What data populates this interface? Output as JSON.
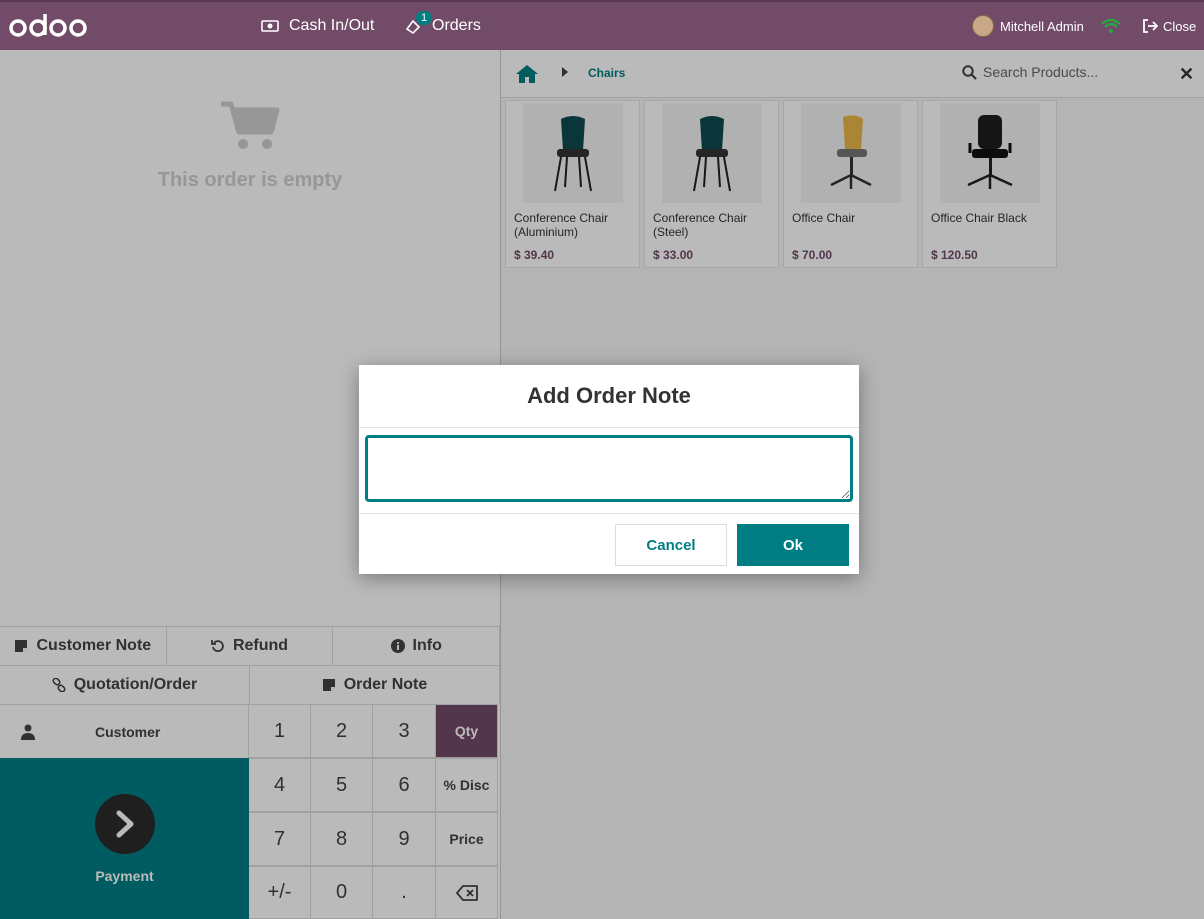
{
  "header": {
    "logo_text": "odoo",
    "cash_label": "Cash In/Out",
    "orders_label": "Orders",
    "orders_count": "1",
    "user_name": "Mitchell Admin",
    "close_label": "Close"
  },
  "order": {
    "empty_text": "This order is empty"
  },
  "controls": {
    "customer_note": "Customer Note",
    "refund": "Refund",
    "info": "Info",
    "quotation": "Quotation/Order",
    "order_note": "Order Note",
    "customer": "Customer",
    "payment": "Payment"
  },
  "numpad": {
    "keys": [
      "1",
      "2",
      "3",
      "Qty",
      "4",
      "5",
      "6",
      "% Disc",
      "7",
      "8",
      "9",
      "Price",
      "+/-",
      "0",
      "."
    ]
  },
  "products_panel": {
    "breadcrumb": "Chairs",
    "search_placeholder": "Search Products...",
    "items": [
      {
        "name": "Conference Chair (Aluminium)",
        "price": "$ 39.40"
      },
      {
        "name": "Conference Chair (Steel)",
        "price": "$ 33.00"
      },
      {
        "name": "Office Chair",
        "price": "$ 70.00"
      },
      {
        "name": "Office Chair Black",
        "price": "$ 120.50"
      }
    ]
  },
  "modal": {
    "title": "Add Order Note",
    "note_value": "",
    "cancel_label": "Cancel",
    "ok_label": "Ok"
  },
  "colors": {
    "brand": "#714b67",
    "accent": "#017e84"
  }
}
